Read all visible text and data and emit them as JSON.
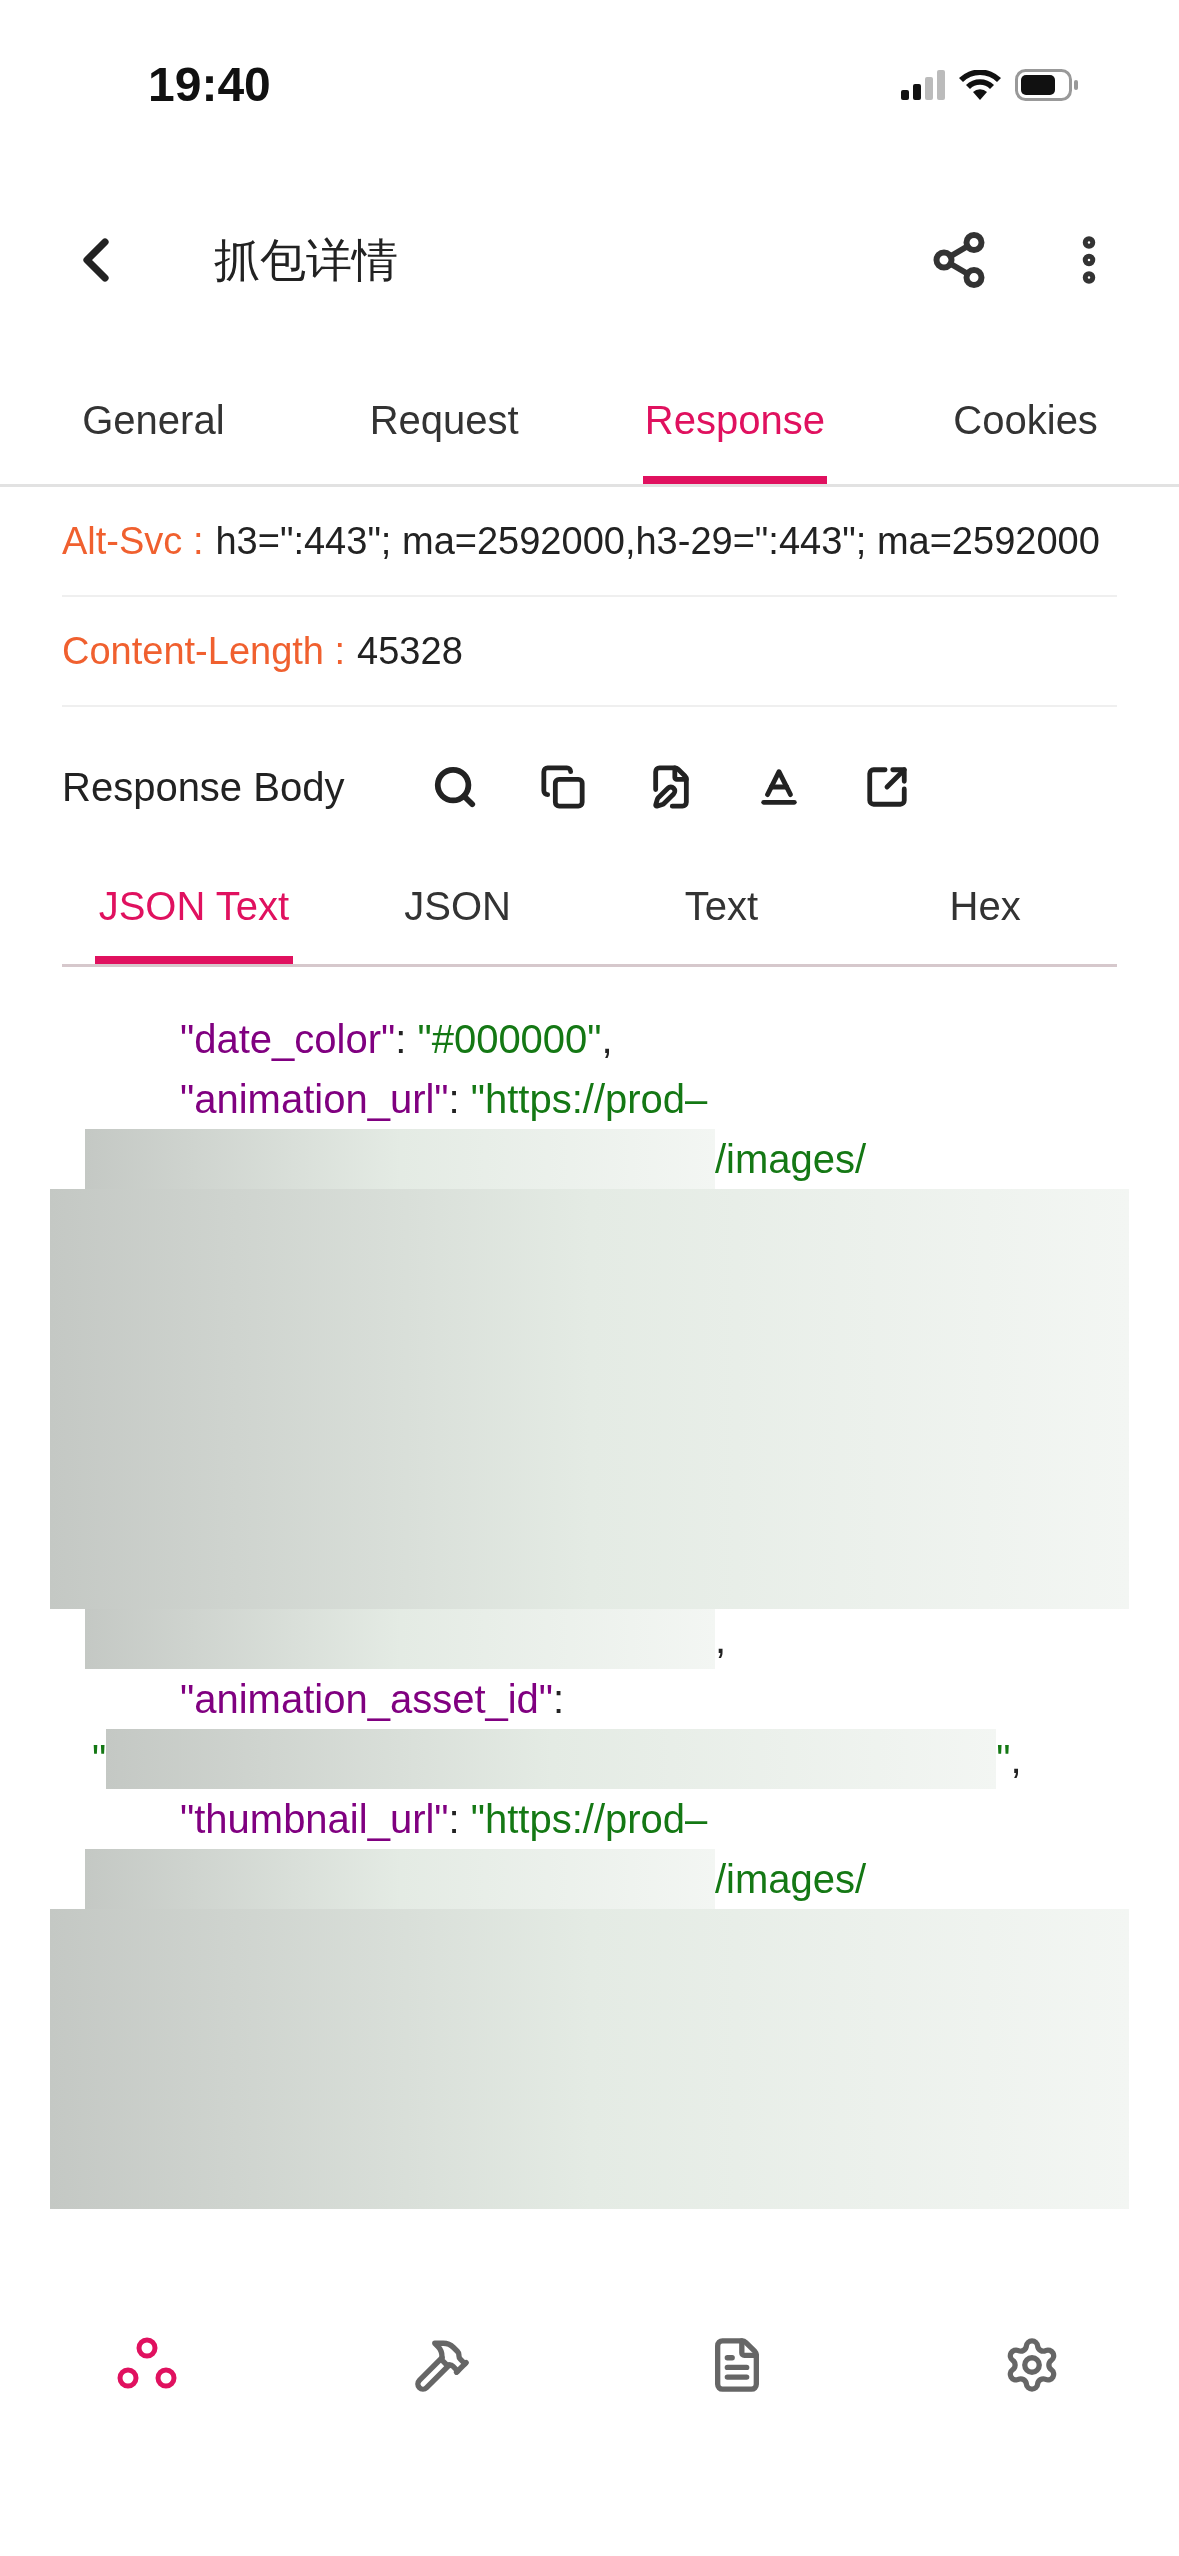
{
  "status_bar": {
    "time": "19:40"
  },
  "header": {
    "title": "抓包详情"
  },
  "tabs": [
    {
      "label": "General",
      "selected": false
    },
    {
      "label": "Request",
      "selected": false
    },
    {
      "label": "Response",
      "selected": true
    },
    {
      "label": "Cookies",
      "selected": false
    }
  ],
  "headers": [
    {
      "name": "Alt-Svc :",
      "value": "h3=\":443\"; ma=2592000,h3-29=\":443\"; ma=2592000"
    },
    {
      "name": "Content-Length :",
      "value": "45328"
    }
  ],
  "response_body": {
    "title": "Response Body"
  },
  "body_tabs": [
    {
      "label": "JSON Text",
      "selected": true
    },
    {
      "label": "JSON",
      "selected": false
    },
    {
      "label": "Text",
      "selected": false
    },
    {
      "label": "Hex",
      "selected": false
    }
  ],
  "code_lines": [
    {
      "kind": "pair",
      "parts": [
        {
          "kind": "key",
          "text": "\"date_color\""
        },
        {
          "kind": "punct",
          "text": ": "
        },
        {
          "kind": "string",
          "text": "\"#000000\""
        },
        {
          "kind": "punct",
          "text": ","
        }
      ]
    },
    {
      "kind": "pair",
      "parts": [
        {
          "kind": "key",
          "text": "\"animation_url\""
        },
        {
          "kind": "punct",
          "text": ": "
        },
        {
          "kind": "string",
          "text": "\"https://prod–"
        }
      ]
    },
    {
      "kind": "continuation",
      "parts": [
        {
          "kind": "redacted"
        },
        {
          "kind": "string",
          "text": "/images/"
        }
      ]
    },
    {
      "kind": "mask"
    },
    {
      "kind": "mask"
    },
    {
      "kind": "mask"
    },
    {
      "kind": "mask"
    },
    {
      "kind": "mask"
    },
    {
      "kind": "mask"
    },
    {
      "kind": "mask"
    },
    {
      "kind": "continuation",
      "parts": [
        {
          "kind": "redacted"
        },
        {
          "kind": "punct",
          "text": ","
        }
      ]
    },
    {
      "kind": "pair",
      "parts": [
        {
          "kind": "key",
          "text": "\"animation_asset_id\""
        },
        {
          "kind": "punct",
          "text": ":"
        }
      ]
    },
    {
      "kind": "value",
      "parts": [
        {
          "kind": "string",
          "text": "\""
        },
        {
          "kind": "redacted"
        },
        {
          "kind": "string",
          "text": "\""
        },
        {
          "kind": "punct",
          "text": ","
        }
      ]
    },
    {
      "kind": "pair",
      "parts": [
        {
          "kind": "key",
          "text": "\"thumbnail_url\""
        },
        {
          "kind": "punct",
          "text": ": "
        },
        {
          "kind": "string",
          "text": "\"https://prod–"
        }
      ]
    },
    {
      "kind": "continuation",
      "parts": [
        {
          "kind": "redacted"
        },
        {
          "kind": "string",
          "text": "/images/"
        }
      ]
    },
    {
      "kind": "mask"
    },
    {
      "kind": "mask"
    },
    {
      "kind": "mask"
    },
    {
      "kind": "mask"
    },
    {
      "kind": "mask"
    }
  ],
  "bottom_nav": [
    {
      "kind": "capture",
      "selected": true
    },
    {
      "kind": "tools",
      "selected": false
    },
    {
      "kind": "document",
      "selected": false
    },
    {
      "kind": "settings",
      "selected": false
    }
  ]
}
